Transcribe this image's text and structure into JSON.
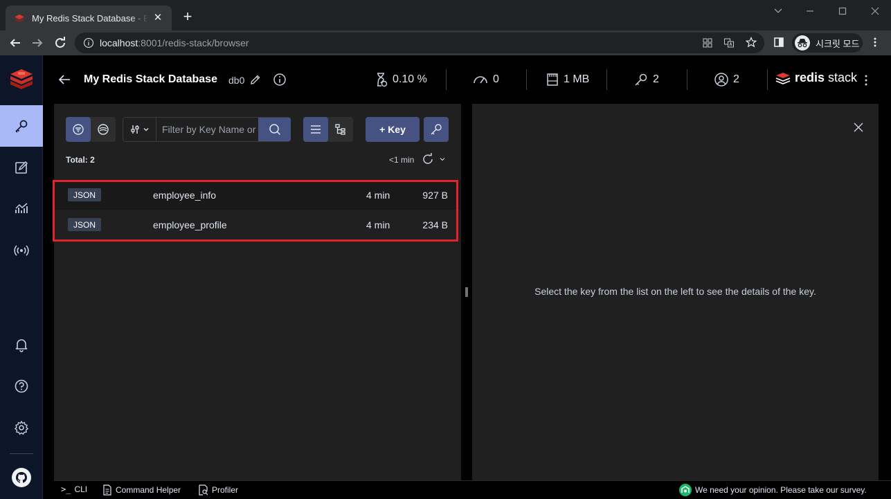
{
  "browser": {
    "tab_title": "My Redis Stack Database - Browser",
    "url_host": "localhost",
    "url_rest": ":8001/redis-stack/browser",
    "profile_label": "시크릿 모드"
  },
  "sidebar": {
    "items": [
      "browser",
      "workbench",
      "analysis",
      "pub-sub"
    ],
    "bottom_items": [
      "notifications",
      "help",
      "settings",
      "github"
    ]
  },
  "header": {
    "db_name": "My Redis Stack Database",
    "db_index": "db0",
    "stats": {
      "cpu": "0.10 %",
      "ops": "0",
      "memory": "1 MB",
      "keys": "2",
      "clients": "2"
    },
    "brand_bold": "redis",
    "brand_light": "stack"
  },
  "list": {
    "search_placeholder": "Filter by Key Name or Pattern",
    "add_key_label": "+ Key",
    "total_label": "Total: 2",
    "refresh_label": "<1 min",
    "rows": [
      {
        "type": "JSON",
        "name": "employee_info",
        "ttl": "4 min",
        "size": "927 B"
      },
      {
        "type": "JSON",
        "name": "employee_profile",
        "ttl": "4 min",
        "size": "234 B"
      }
    ]
  },
  "details": {
    "empty_message": "Select the key from the list on the left to see the details of the key."
  },
  "bottombar": {
    "cli": "CLI",
    "command_helper": "Command Helper",
    "profiler": "Profiler",
    "survey": "We need your opinion. Please take our survey."
  },
  "colors": {
    "accent": "#465282",
    "active_nav": "#a9b9f8",
    "highlight": "#e0232c",
    "redis_red": "#dc382d"
  }
}
